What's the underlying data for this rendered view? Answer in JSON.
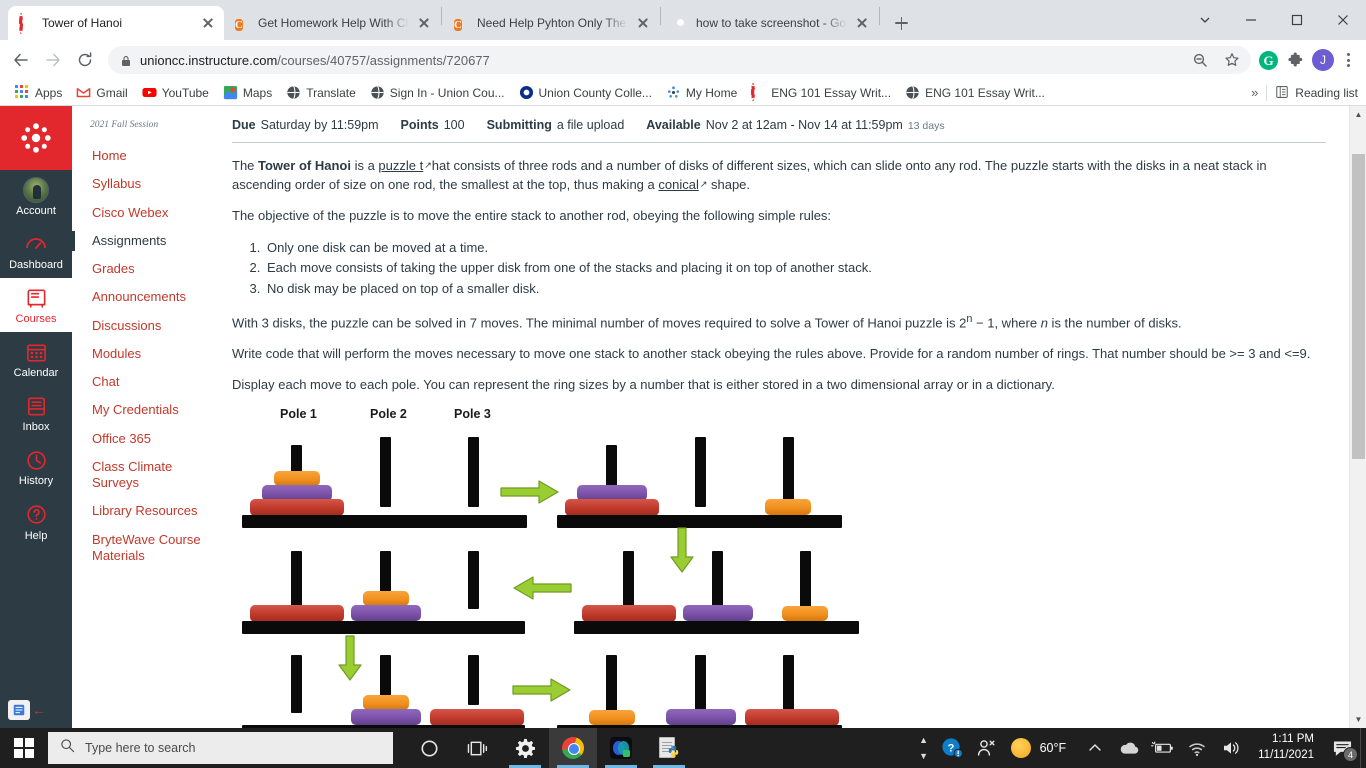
{
  "browser": {
    "tabs": [
      {
        "title": "Tower of Hanoi",
        "favicon": "canvas-icon",
        "active": true
      },
      {
        "title": "Get Homework Help With Chegg",
        "favicon": "chegg-icon",
        "active": false
      },
      {
        "title": "Need Help Pyhton Only The Tow",
        "favicon": "chegg-icon",
        "active": false
      },
      {
        "title": "how to take screenshot - Google",
        "favicon": "google-icon",
        "active": false
      }
    ],
    "new_tab_label": "+",
    "url": "unioncc.instructure.com",
    "url_path": "/courses/40757/assignments/720677",
    "window_controls": {
      "minimize": "–",
      "maximize": "□",
      "close": "✕",
      "tab_search": "⌄"
    },
    "profile_initial": "J",
    "extension_initial": "G",
    "bookmarks": [
      {
        "label": "Apps",
        "icon": "apps-grid-icon"
      },
      {
        "label": "Gmail",
        "icon": "gmail-icon"
      },
      {
        "label": "YouTube",
        "icon": "youtube-icon"
      },
      {
        "label": "Maps",
        "icon": "maps-icon"
      },
      {
        "label": "Translate",
        "icon": "translate-icon"
      },
      {
        "label": "Sign In - Union Cou...",
        "icon": "translate-icon"
      },
      {
        "label": "Union County Colle...",
        "icon": "o-circle-icon"
      },
      {
        "label": "My Home",
        "icon": "myhome-icon"
      },
      {
        "label": "ENG 101 Essay Writ...",
        "icon": "canvas-icon"
      },
      {
        "label": "ENG 101 Essay Writ...",
        "icon": "translate-icon"
      }
    ],
    "bookmarks_overflow": "»",
    "reading_list": "Reading list"
  },
  "canvas": {
    "global_nav": [
      {
        "label": "Account",
        "icon": "avatar-icon",
        "active": false
      },
      {
        "label": "Dashboard",
        "icon": "dashboard-icon",
        "active": false
      },
      {
        "label": "Courses",
        "icon": "courses-icon",
        "active": true
      },
      {
        "label": "Calendar",
        "icon": "calendar-icon",
        "active": false
      },
      {
        "label": "Inbox",
        "icon": "inbox-icon",
        "active": false
      },
      {
        "label": "History",
        "icon": "history-icon",
        "active": false
      },
      {
        "label": "Help",
        "icon": "help-icon",
        "active": false
      }
    ],
    "term_label": "2021 Fall Session",
    "course_nav": [
      {
        "label": "Home",
        "active": false
      },
      {
        "label": "Syllabus",
        "active": false
      },
      {
        "label": "Cisco Webex",
        "active": false
      },
      {
        "label": "Assignments",
        "active": true
      },
      {
        "label": "Grades",
        "active": false
      },
      {
        "label": "Announcements",
        "active": false
      },
      {
        "label": "Discussions",
        "active": false
      },
      {
        "label": "Modules",
        "active": false
      },
      {
        "label": "Chat",
        "active": false
      },
      {
        "label": "My Credentials",
        "active": false
      },
      {
        "label": "Office 365",
        "active": false
      },
      {
        "label": "Class Climate Surveys",
        "active": false
      },
      {
        "label": "Library Resources",
        "active": false
      },
      {
        "label": "BryteWave Course Materials",
        "active": false
      }
    ]
  },
  "assignment": {
    "meta": [
      {
        "key": "Due",
        "value": "Saturday by 11:59pm",
        "extra": ""
      },
      {
        "key": "Points",
        "value": "100",
        "extra": ""
      },
      {
        "key": "Submitting",
        "value": "a file upload",
        "extra": ""
      },
      {
        "key": "Available",
        "value": "Nov 2 at 12am - Nov 14 at 11:59pm",
        "extra": "13 days"
      }
    ],
    "para1_a": "The ",
    "para1_bold": "Tower of Hanoi",
    "para1_b": "  is a ",
    "link1": "puzzle t",
    "para1_c": "hat consists of three rods and a number of disks of different sizes, which can slide onto any rod. The puzzle starts with the disks in a neat stack in ascending order of size on one rod, the smallest at the top, thus making a ",
    "link2": "conical",
    "para1_d": " shape.",
    "para2": "The objective of the puzzle is to move the entire stack to another rod, obeying the following simple rules:",
    "rules": [
      "Only one disk can be moved at a time.",
      "Each move consists of taking the upper disk from one of the stacks and placing it on top of another stack.",
      "No disk may be placed on top of a smaller disk."
    ],
    "para3_a": "With 3 disks, the puzzle can be solved in 7 moves. The minimal number of moves required to solve a Tower of Hanoi puzzle is 2",
    "para3_sup": "n",
    "para3_b": " − 1, where ",
    "para3_i": "n",
    "para3_c": " is the number of disks.",
    "para4": "Write code that will perform the moves necessary to move one stack to another stack obeying the rules above.  Provide for a random number of rings.  That number should be >= 3 and <=9.",
    "para5": "Display each move to each pole.  You can represent the ring sizes by a number that is either stored in a two dimensional array or in a dictionary.",
    "figure": {
      "pole_labels": [
        "Pole 1",
        "Pole 2",
        "Pole 3"
      ],
      "colors": {
        "red": "#C0392B",
        "purple": "#7B52A8",
        "orange": "#F0901E",
        "arrow": "#9ACD32",
        "rod": "#0a0a0a"
      },
      "states": [
        {
          "id": "state-1",
          "poles": [
            [
              "red",
              "purple",
              "orange"
            ],
            [],
            []
          ]
        },
        {
          "id": "state-2",
          "poles": [
            [
              "red",
              "purple"
            ],
            [],
            [
              "orange"
            ]
          ]
        },
        {
          "id": "state-3",
          "poles": [
            [
              "red"
            ],
            [
              "purple",
              "orange"
            ],
            []
          ]
        },
        {
          "id": "state-4",
          "poles": [
            [
              "red"
            ],
            [
              "purple"
            ],
            [
              "orange"
            ]
          ]
        },
        {
          "id": "state-5",
          "poles": [
            [],
            [
              "purple",
              "orange"
            ],
            [
              "red"
            ]
          ]
        },
        {
          "id": "state-6",
          "poles": [
            [
              "orange"
            ],
            [
              "purple"
            ],
            [
              "red"
            ]
          ]
        }
      ]
    }
  },
  "scrollbar": {
    "up": "▲",
    "down": "▼"
  },
  "taskbar": {
    "search_placeholder": "Type here to search",
    "apps": [
      {
        "name": "cortana-icon",
        "open": false,
        "focused": false
      },
      {
        "name": "task-view-icon",
        "open": false,
        "focused": false
      },
      {
        "name": "settings-icon",
        "open": true,
        "focused": false
      },
      {
        "name": "chrome-icon",
        "open": true,
        "focused": true
      },
      {
        "name": "office-icon",
        "open": true,
        "focused": false
      },
      {
        "name": "python-file-icon",
        "open": true,
        "focused": false
      }
    ],
    "tray": {
      "temperature": "60°F",
      "time": "1:11 PM",
      "date": "11/11/2021",
      "notification_count": "4"
    }
  }
}
